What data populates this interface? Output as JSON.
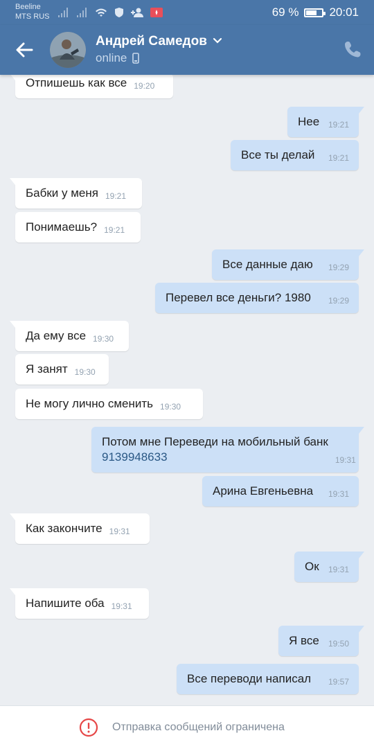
{
  "status_bar": {
    "carrier1": "Beeline",
    "carrier2": "MTS RUS",
    "battery": "69 %",
    "battery_level": 0.69,
    "time": "20:01"
  },
  "header": {
    "contact_name": "Андрей Самедов",
    "status": "online",
    "accent_color": "#4a76a8"
  },
  "messages": [
    {
      "dir": "in",
      "text": "Отпишешь как все",
      "time": "19:20"
    },
    {
      "dir": "out",
      "text": "Нее",
      "time": "19:21"
    },
    {
      "dir": "out",
      "text": "Все ты делай",
      "time": "19:21"
    },
    {
      "dir": "in",
      "text": "Бабки у меня",
      "time": "19:21"
    },
    {
      "dir": "in",
      "text": "Понимаешь?",
      "time": "19:21"
    },
    {
      "dir": "out",
      "text": "Все данные даю",
      "time": "19:29"
    },
    {
      "dir": "out",
      "text": "Перевел все деньги? 1980",
      "time": "19:29"
    },
    {
      "dir": "in",
      "text": "Да ему все",
      "time": "19:30"
    },
    {
      "dir": "in",
      "text": "Я занят",
      "time": "19:30"
    },
    {
      "dir": "in",
      "text": "Не могу лично сменить",
      "time": "19:30"
    },
    {
      "dir": "out",
      "text": "Потом мне Переведи на мобильный банк",
      "link": "9139948633",
      "time": "19:31"
    },
    {
      "dir": "out",
      "text": "Арина Евгеньевна",
      "time": "19:31"
    },
    {
      "dir": "in",
      "text": "Как закончите",
      "time": "19:31"
    },
    {
      "dir": "out",
      "text": "Ок",
      "time": "19:31"
    },
    {
      "dir": "in",
      "text": "Напишите оба",
      "time": "19:31"
    },
    {
      "dir": "out",
      "text": "Я все",
      "time": "19:50"
    },
    {
      "dir": "out",
      "text": "Все переводи написал",
      "time": "19:57"
    }
  ],
  "footer": {
    "restriction_text": "Отправка сообщений ограничена",
    "warning_color": "#e64646"
  }
}
